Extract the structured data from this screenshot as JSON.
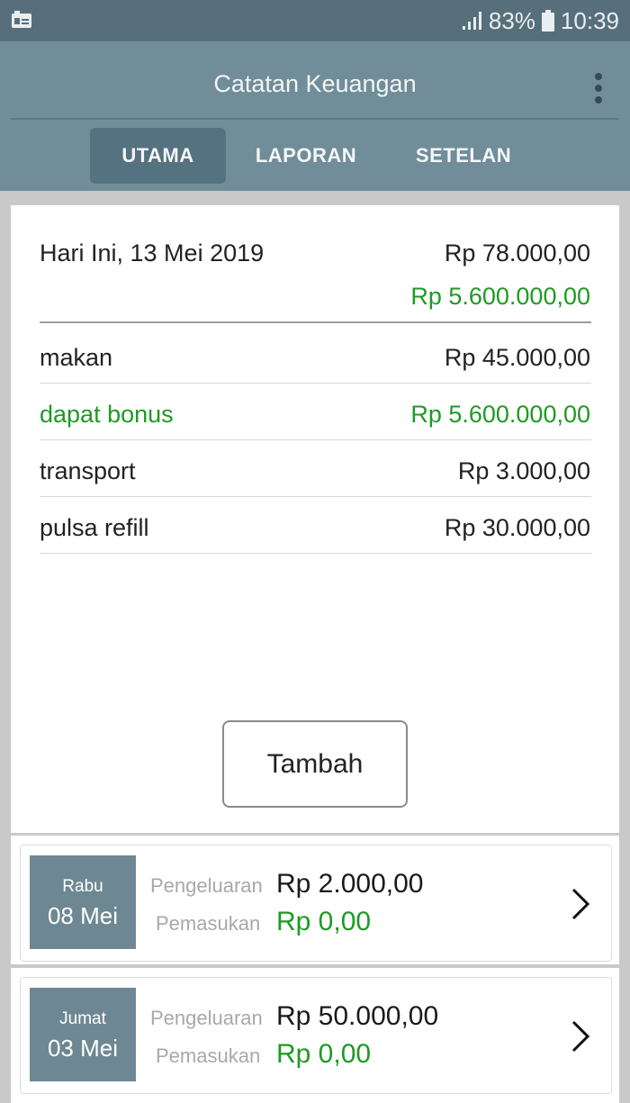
{
  "status_bar": {
    "battery": "83%",
    "time": "10:39"
  },
  "app_bar": {
    "title": "Catatan Keuangan",
    "tabs": [
      {
        "label": "UTAMA",
        "active": true
      },
      {
        "label": "LAPORAN",
        "active": false
      },
      {
        "label": "SETELAN",
        "active": false
      }
    ]
  },
  "today": {
    "date_label": "Hari Ini, 13 Mei 2019",
    "total_expense": "Rp 78.000,00",
    "total_income": "Rp 5.600.000,00",
    "transactions": [
      {
        "name": "makan",
        "amount": "Rp 45.000,00",
        "type": "expense"
      },
      {
        "name": "dapat bonus",
        "amount": "Rp 5.600.000,00",
        "type": "income"
      },
      {
        "name": "transport",
        "amount": "Rp 3.000,00",
        "type": "expense"
      },
      {
        "name": "pulsa refill",
        "amount": "Rp 30.000,00",
        "type": "expense"
      }
    ],
    "add_button": "Tambah"
  },
  "days": [
    {
      "weekday": "Rabu",
      "date": "08 Mei",
      "expense_label": "Pengeluaran",
      "expense": "Rp 2.000,00",
      "income_label": "Pemasukan",
      "income": "Rp 0,00"
    },
    {
      "weekday": "Jumat",
      "date": "03 Mei",
      "expense_label": "Pengeluaran",
      "expense": "Rp 50.000,00",
      "income_label": "Pemasukan",
      "income": "Rp 0,00"
    }
  ],
  "colors": {
    "status_bar": "#566f7b",
    "app_bar": "#708d99",
    "active_tab": "#557280",
    "income_green": "#1f9a24",
    "date_box": "#6e8893"
  }
}
